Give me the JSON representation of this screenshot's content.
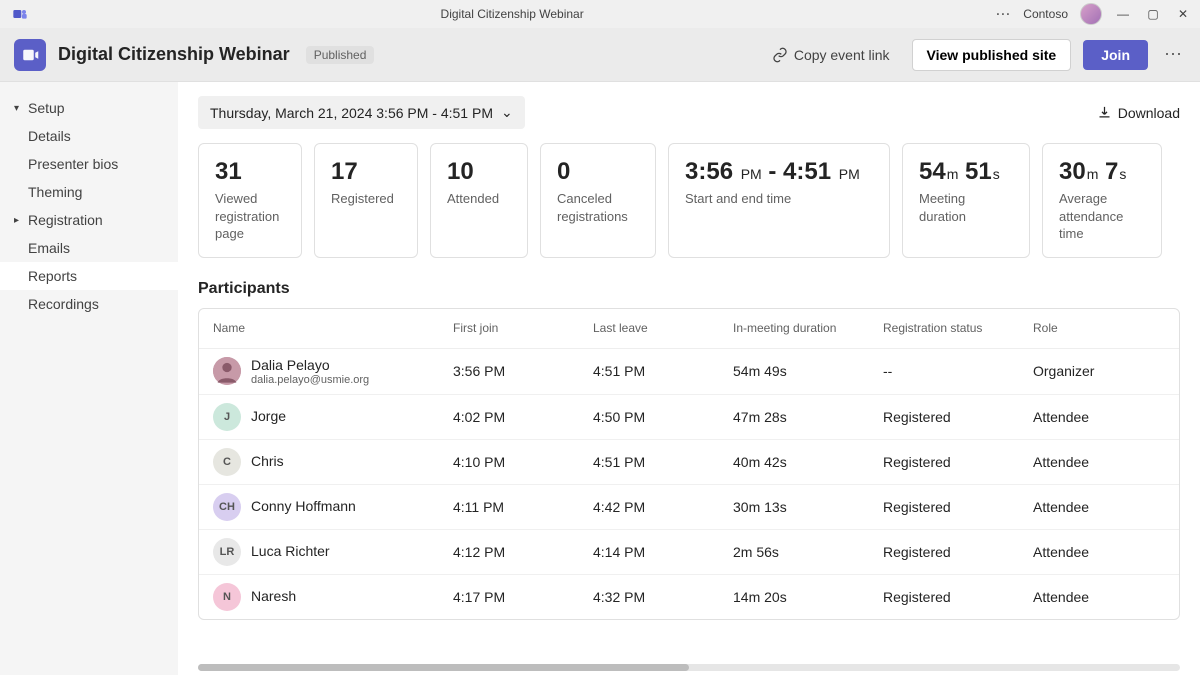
{
  "titlebar": {
    "title": "Digital Citizenship Webinar",
    "org": "Contoso"
  },
  "header": {
    "title": "Digital Citizenship Webinar",
    "status_badge": "Published",
    "copy_link": "Copy event link",
    "view_site": "View published site",
    "join": "Join"
  },
  "sidebar": {
    "setup_label": "Setup",
    "details": "Details",
    "presenter_bios": "Presenter bios",
    "theming": "Theming",
    "registration_label": "Registration",
    "emails": "Emails",
    "reports": "Reports",
    "recordings": "Recordings"
  },
  "toprow": {
    "date_range": "Thursday, March 21, 2024 3:56 PM - 4:51 PM",
    "download": "Download"
  },
  "cards": {
    "viewed": {
      "value": "31",
      "label": "Viewed registration page"
    },
    "registered": {
      "value": "17",
      "label": "Registered"
    },
    "attended": {
      "value": "10",
      "label": "Attended"
    },
    "canceled": {
      "value": "0",
      "label": "Canceled registrations"
    },
    "startend": {
      "value_html": "3:56 <span class='unit'>PM</span> - 4:51 <span class='unit'>PM</span>",
      "value_text": "3:56 PM - 4:51 PM",
      "label": "Start and end time"
    },
    "duration": {
      "m": "54",
      "s": "51",
      "label": "Meeting duration"
    },
    "avg": {
      "m": "30",
      "s": "7",
      "label": "Average attendance time"
    }
  },
  "participants_title": "Participants",
  "columns": {
    "name": "Name",
    "first_join": "First join",
    "last_leave": "Last leave",
    "in_meeting": "In-meeting duration",
    "reg_status": "Registration status",
    "role": "Role"
  },
  "rows": [
    {
      "initials": "",
      "avatar_bg": "#c79aa8",
      "name": "Dalia Pelayo",
      "email": "dalia.pelayo@usmie.org",
      "first": "3:56 PM",
      "last": "4:51 PM",
      "dur": "54m 49s",
      "reg": "--",
      "role": "Organizer",
      "is_photo": true
    },
    {
      "initials": "J",
      "avatar_bg": "#cce8dc",
      "name": "Jorge",
      "email": "",
      "first": "4:02 PM",
      "last": "4:50 PM",
      "dur": "47m 28s",
      "reg": "Registered",
      "role": "Attendee"
    },
    {
      "initials": "C",
      "avatar_bg": "#e6e6e0",
      "name": "Chris",
      "email": "",
      "first": "4:10 PM",
      "last": "4:51 PM",
      "dur": "40m 42s",
      "reg": "Registered",
      "role": "Attendee"
    },
    {
      "initials": "CH",
      "avatar_bg": "#d8cef0",
      "name": "Conny Hoffmann",
      "email": "",
      "first": "4:11 PM",
      "last": "4:42 PM",
      "dur": "30m 13s",
      "reg": "Registered",
      "role": "Attendee"
    },
    {
      "initials": "LR",
      "avatar_bg": "#e8e8e8",
      "name": "Luca Richter",
      "email": "",
      "first": "4:12 PM",
      "last": "4:14 PM",
      "dur": "2m 56s",
      "reg": "Registered",
      "role": "Attendee"
    },
    {
      "initials": "N",
      "avatar_bg": "#f5c6d8",
      "name": "Naresh",
      "email": "",
      "first": "4:17 PM",
      "last": "4:32 PM",
      "dur": "14m 20s",
      "reg": "Registered",
      "role": "Attendee"
    }
  ]
}
